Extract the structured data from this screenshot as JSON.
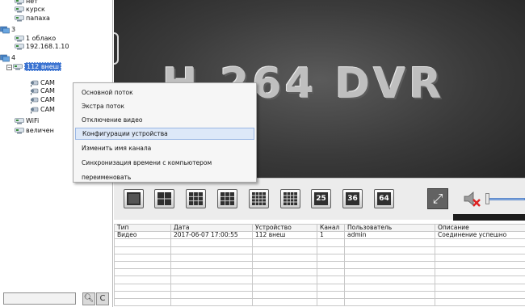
{
  "tree": {
    "items": [
      {
        "label": "нет",
        "depth": 1,
        "type": "device"
      },
      {
        "label": "курск",
        "depth": 1,
        "type": "device"
      },
      {
        "label": "папаха",
        "depth": 1,
        "type": "device"
      },
      {
        "label": "3",
        "depth": 0,
        "type": "group"
      },
      {
        "label": "1 облако",
        "depth": 1,
        "type": "device"
      },
      {
        "label": "192.168.1.10",
        "depth": 1,
        "type": "device"
      },
      {
        "label": "4",
        "depth": 0,
        "type": "group"
      },
      {
        "label": "112 внеш",
        "depth": 1,
        "type": "device",
        "selected": true,
        "expander": "-"
      },
      {
        "label": "CAM",
        "depth": 2,
        "type": "camera"
      },
      {
        "label": "CAM",
        "depth": 2,
        "type": "camera"
      },
      {
        "label": "CAM",
        "depth": 2,
        "type": "camera"
      },
      {
        "label": "CAM",
        "depth": 2,
        "type": "camera"
      },
      {
        "label": "WiFi",
        "depth": 1,
        "type": "device"
      },
      {
        "label": "величен",
        "depth": 1,
        "type": "device"
      }
    ],
    "search_value": "",
    "search_icon": "magnifier-icon",
    "refresh_icon": "refresh-icon"
  },
  "video": {
    "logo_text": "H.264 DVR"
  },
  "context_menu": {
    "items": [
      "Основной поток",
      "Экстра поток",
      "Отключение видео",
      "Конфигурации устройства",
      "Изменить имя канала",
      "Синхронизация времени с компьютером",
      "переименовать"
    ],
    "highlighted_index": 3
  },
  "layout_bar": {
    "buttons": [
      {
        "name": "layout-1",
        "label": ""
      },
      {
        "name": "layout-4",
        "label": ""
      },
      {
        "name": "layout-6",
        "label": ""
      },
      {
        "name": "layout-9",
        "label": ""
      },
      {
        "name": "layout-13",
        "label": ""
      },
      {
        "name": "layout-16",
        "label": ""
      },
      {
        "name": "layout-25",
        "label": "25"
      },
      {
        "name": "layout-36",
        "label": "36"
      },
      {
        "name": "layout-64",
        "label": "64"
      }
    ],
    "fullscreen_icon": "fullscreen-icon",
    "mute_icon": "speaker-muted-icon",
    "volume_level": 0.05
  },
  "log": {
    "columns": [
      "Тип",
      "Дата",
      "Устройство",
      "Канал",
      "Пользователь",
      "Описание"
    ],
    "rows": [
      [
        "Видео",
        "2017-06-07 17:00:55",
        "112 внеш",
        "1",
        "admin",
        "Соединение успешно"
      ]
    ],
    "empty_rows": 9
  },
  "colors": {
    "selection": "#3b73d1",
    "menu_highlight": "#dde8f8",
    "video_bg": "#3a3a3a"
  }
}
